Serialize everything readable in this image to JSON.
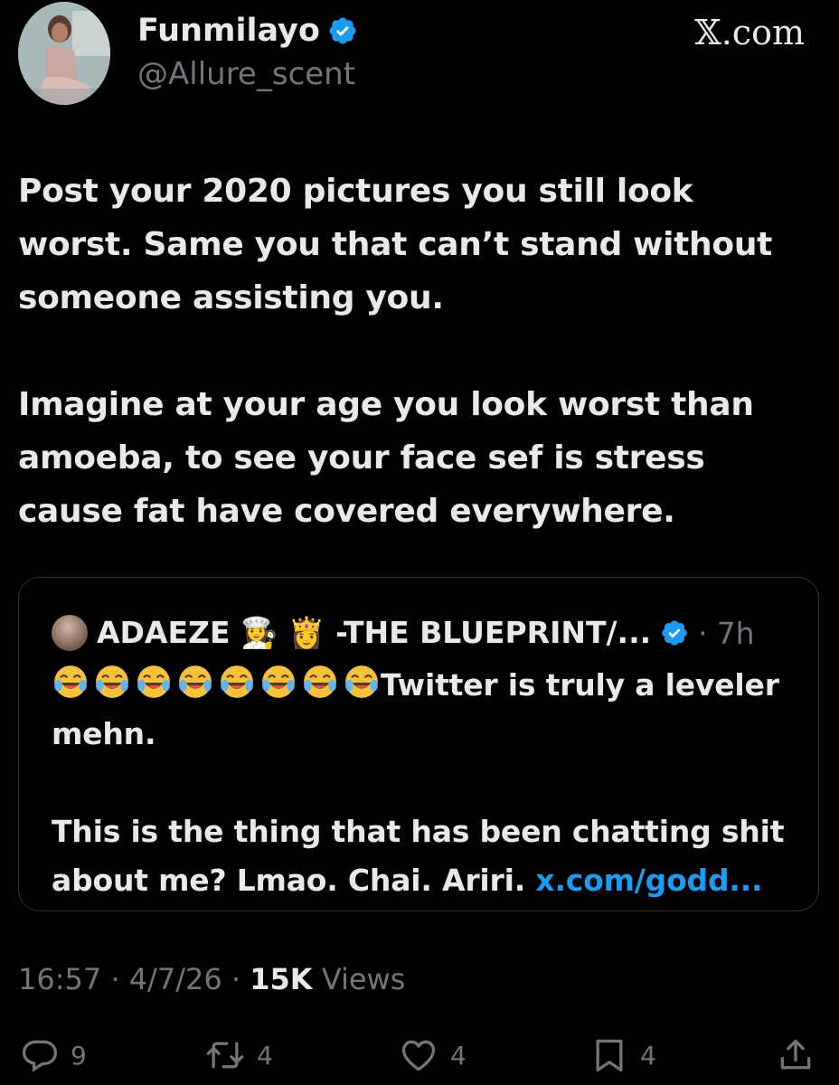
{
  "author": {
    "display_name": "Funmilayo",
    "handle": "@Allure_scent",
    "verified": true
  },
  "brand": "𝕏.com",
  "tweet": {
    "text": "Post your 2020 pictures you still look worst. Same you that can’t stand without someone assisting you.\n\nImagine at your age you look worst than amoeba, to see your face sef is stress cause fat have covered everywhere."
  },
  "quote": {
    "name": "ADAEZE 👩‍🍳 👸 -THE BLUEPRINT/...",
    "verified": true,
    "separator": "·",
    "time": "7h",
    "emoji_prefix": "😂😂😂😂😂😂😂😂",
    "text_line1": "Twitter is truly a leveler mehn.\n\nThis is the thing that has been chatting shit about me? Lmao. Chai. Ariri. ",
    "link": "x.com/godd..."
  },
  "meta": {
    "time": "16:57",
    "date": "4/7/26",
    "views_count": "15K",
    "views_label": "Views"
  },
  "actions": {
    "replies": "9",
    "reposts": "4",
    "likes": "4",
    "bookmarks": "4"
  },
  "colors": {
    "background": "#000000",
    "text_primary": "#e7e9ea",
    "text_secondary": "#71767b",
    "verified_blue": "#1d9bf0",
    "link_blue": "#1d9bf0",
    "card_border": "#2f3336"
  },
  "icons": [
    "verified-badge-icon",
    "reply-icon",
    "repost-icon",
    "like-icon",
    "bookmark-icon",
    "share-icon",
    "laughing-emoji-icon"
  ]
}
